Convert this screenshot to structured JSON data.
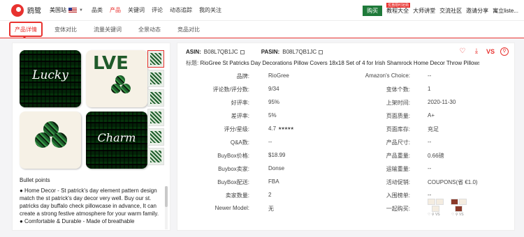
{
  "topbar": {
    "brand": "鸥鹭",
    "site": "美国站",
    "nav": [
      "品类",
      "产品",
      "关键词",
      "评论",
      "动态追踪",
      "我的关注"
    ],
    "active_nav": "产品",
    "buy_label": "购买",
    "badge": "优惠限时抢购",
    "right_links": [
      "教程大全",
      "大师讲堂",
      "交流社区",
      "邀请分享",
      "寓立liste..."
    ]
  },
  "tabs": [
    "产品详情",
    "变体对比",
    "流量关键词",
    "全景动态",
    "竞品对比"
  ],
  "left": {
    "pillow_texts": [
      "Lucky",
      "LVE",
      "Charm"
    ],
    "bullets_title": "Bullet points",
    "bullets": [
      "● Home Decor - St patrick's day element pattern design match the st patrick's day decor very well. Buy our st. patricks day buffalo check pillowcase in advance, It can create a strong festive atmosphere for your warm family.",
      "● Comfortable & Durable - Made of breathable"
    ]
  },
  "right": {
    "asin_label": "ASIN:",
    "asin": "B08L7QB1JC",
    "pasin_label": "PASIN:",
    "pasin": "B08L7QB1JC",
    "title_label": "标题:",
    "title": "RioGree St Patricks Day Decorations Pillow Covers 18x18 Set of 4 for Irish Shamrock Home Decor Throw Pillows ...",
    "actions": [
      "heart-icon",
      "download-icon",
      "vs-icon",
      "link-icon"
    ],
    "vs_label": "VS",
    "left_col": [
      {
        "k": "品牌:",
        "v": "RioGree"
      },
      {
        "k": "评论数/评分数:",
        "v": "9/34"
      },
      {
        "k": "好评率:",
        "v": "95%"
      },
      {
        "k": "差评率:",
        "v": "5%"
      },
      {
        "k": "评分/星级:",
        "v": "4.7",
        "stars": "★★★★★"
      },
      {
        "k": "Q&A数:",
        "v": "--"
      },
      {
        "k": "BuyBox价格:",
        "v": "$18.99"
      },
      {
        "k": "Buybox卖家:",
        "v": "Donse"
      },
      {
        "k": "BuyBox配送:",
        "v": "FBA"
      },
      {
        "k": "卖家数量:",
        "v": "2"
      },
      {
        "k": "Newer Model:",
        "v": "无"
      }
    ],
    "right_col": [
      {
        "k": "Amazon's Choice:",
        "v": "--"
      },
      {
        "k": "变体个数:",
        "v": "1"
      },
      {
        "k": "上架时间:",
        "v": "2020-11-30"
      },
      {
        "k": "页面质量:",
        "v": "A+"
      },
      {
        "k": "页面库存:",
        "v": "充足"
      },
      {
        "k": "产品尺寸:",
        "v": "--"
      },
      {
        "k": "产品重量:",
        "v": "0.66磅"
      },
      {
        "k": "运输重量:",
        "v": "--"
      },
      {
        "k": "活动促销:",
        "v": "COUPONS(省 €1.0)"
      },
      {
        "k": "入围榜单:",
        "v": "--"
      },
      {
        "k": "一起购买:",
        "v": ""
      }
    ],
    "bought_together_icons": [
      "heart-icon",
      "link-icon",
      "vs-icon",
      "vs-label"
    ],
    "bought_together_vs": "VS"
  }
}
